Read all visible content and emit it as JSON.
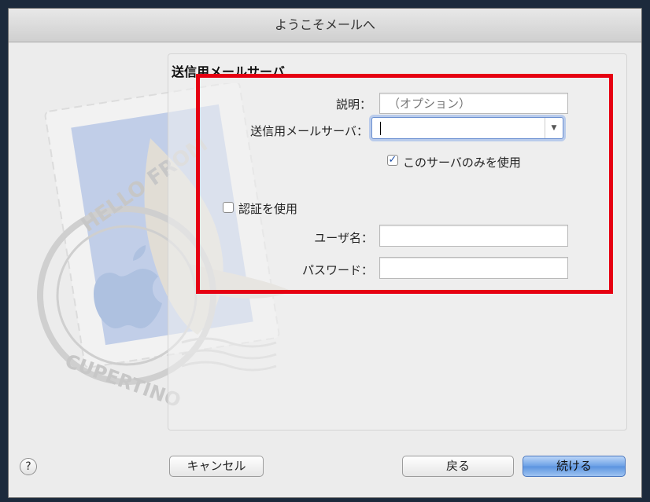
{
  "window": {
    "title": "ようこそメールへ"
  },
  "section": {
    "title": "送信用メールサーバ"
  },
  "form": {
    "description_label": "説明：",
    "description_placeholder": "（オプション）",
    "smtp_label": "送信用メールサーバ：",
    "smtp_value": "",
    "only_this_server_label": "このサーバのみを使用",
    "only_this_server_checked": true,
    "use_auth_label": "認証を使用",
    "use_auth_checked": false,
    "username_label": "ユーザ名：",
    "username_value": "",
    "password_label": "パスワード：",
    "password_value": ""
  },
  "stamp": {
    "top_text": "HELLO FROM",
    "bottom_text": "CUPERTINO"
  },
  "buttons": {
    "help": "?",
    "cancel": "キャンセル",
    "back": "戻る",
    "continue": "続ける"
  },
  "colors": {
    "highlight": "#e60012",
    "primary_button": "#5b93df"
  }
}
